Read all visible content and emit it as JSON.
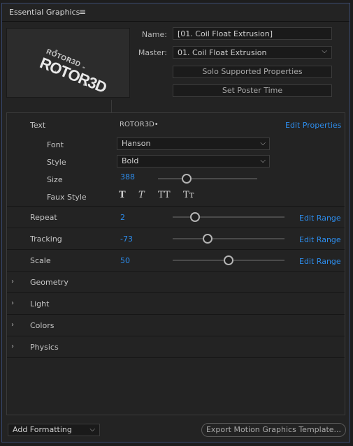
{
  "panel": {
    "title": "Essential Graphics",
    "menu_icon": "hamburger-icon"
  },
  "preview": {
    "logo_text": "ROTOR3D"
  },
  "info": {
    "name_label": "Name:",
    "name_value": "[01. Coil Float Extrusion]",
    "master_label": "Master:",
    "master_value": "01. Coil Float Extrusion",
    "solo_button": "Solo Supported Properties",
    "poster_button": "Set Poster Time"
  },
  "text_section": {
    "label": "Text",
    "value": "ROTOR3D•",
    "edit_link": "Edit Properties",
    "font_label": "Font",
    "font_value": "Hanson",
    "style_label": "Style",
    "style_value": "Bold",
    "size_label": "Size",
    "size_value": "388",
    "size_fraction": 0.29,
    "faux_label": "Faux Style",
    "faux_options": [
      "T",
      "T",
      "TT",
      "Tт"
    ]
  },
  "properties": [
    {
      "label": "Repeat",
      "value": "2",
      "link": "Edit Range",
      "fraction": 0.2
    },
    {
      "label": "Tracking",
      "value": "-73",
      "link": "Edit Range",
      "fraction": 0.31
    },
    {
      "label": "Scale",
      "value": "50",
      "link": "Edit Range",
      "fraction": 0.5
    }
  ],
  "groups": [
    "Geometry",
    "Light",
    "Colors",
    "Physics"
  ],
  "footer": {
    "add_formatting": "Add Formatting",
    "export_button": "Export Motion Graphics Template..."
  },
  "colors": {
    "accent": "#2d8ceb",
    "panel_border": "#3a4a70",
    "background": "#232323"
  }
}
